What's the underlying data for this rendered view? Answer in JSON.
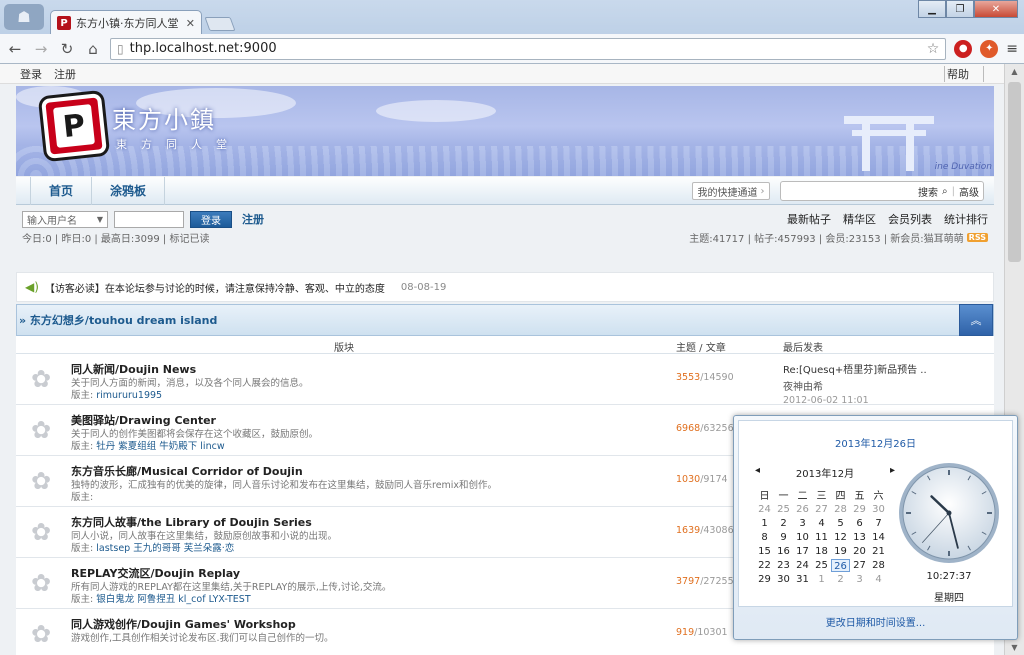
{
  "browser": {
    "tab_title": "东方小镇·东方同人堂 - Po",
    "tab_favicon": "P",
    "url": "thp.localhost.net:9000",
    "url_port": ":9000",
    "url_host": "thp.localhost.net"
  },
  "topbar": {
    "login": "登录",
    "register": "注册",
    "help": "帮助"
  },
  "banner": {
    "title": "東方小鎮",
    "subtitle": "東方同人堂",
    "caption": "ine Duvation"
  },
  "nav": {
    "items": [
      "首页",
      "涂鸦板"
    ],
    "quick": "我的快捷通道",
    "search": "搜索",
    "advanced": "高级"
  },
  "login": {
    "username_placeholder": "输入用户名",
    "button": "登录",
    "register": "注册",
    "links": [
      "最新帖子",
      "精华区",
      "会员列表",
      "统计排行"
    ]
  },
  "stats": {
    "left": "今日:0 | 昨日:0 | 最高日:3099 | 标记已读",
    "right": "主题:41717 | 帖子:457993 | 会员:23153 | 新会员:猫耳萌萌",
    "rss": "RSS"
  },
  "notice": {
    "text": "【访客必读】在本论坛参与讨论的时候，请注意保持冷静、客观、中立的态度",
    "date": "08-08-19"
  },
  "category": {
    "title": "» 东方幻想乡/touhou dream island",
    "col_forum": "版块",
    "col_count": "主题 / 文章",
    "col_last": "最后发表"
  },
  "forums": [
    {
      "name": "同人新闻/Doujin News",
      "desc": "关于同人方面的新闻，消息，以及各个同人展会的信息。",
      "mod_label": "版主:",
      "mods": "rimururu1995",
      "threads": "3553",
      "posts": "/14590",
      "last_title": "Re:[Quesq+梧里芬]新品预告 ..",
      "last_by": "夜神由希",
      "last_time": "2012-06-02 11:01"
    },
    {
      "name": "美图驿站/Drawing Center",
      "desc": "关于同人的创作美图都将会保存在这个收藏区，鼓励原创。",
      "mod_label": "版主:",
      "mods": "牡丹 紫夏组组 牛奶殿下 lincw",
      "threads": "6968",
      "posts": "/63256",
      "last_title": "",
      "last_by": "",
      "last_time": ""
    },
    {
      "name": "东方音乐长廊/Musical Corridor of Doujin",
      "desc": "独特的波形，汇成独有的优美的旋律，同人音乐讨论和发布在这里集结，鼓励同人音乐remix和创作。",
      "mod_label": "版主:",
      "mods": "",
      "threads": "1030",
      "posts": "/9174",
      "last_title": "",
      "last_by": "",
      "last_time": ""
    },
    {
      "name": "东方同人故事/the Library of Doujin Series",
      "desc": "同人小说，同人故事在这里集结，鼓励原创故事和小说的出现。",
      "mod_label": "版主:",
      "mods": "lastsep 王九的哥哥 芙兰朵露·恋",
      "threads": "1639",
      "posts": "/43086",
      "last_title": "",
      "last_by": "",
      "last_time": ""
    },
    {
      "name": "REPLAY交流区/Doujin Replay",
      "desc": "所有同人游戏的REPLAY都在这里集结,关于REPLAY的展示,上传,讨论,交流。",
      "mod_label": "版主:",
      "mods": "银白鬼龙 阿鲁捏丑 kl_cof LYX-TEST",
      "threads": "3797",
      "posts": "/27255",
      "last_title": "",
      "last_by": "",
      "last_time": ""
    },
    {
      "name": "同人游戏创作/Doujin Games' Workshop",
      "desc": "游戏创作,工具创作相关讨论发布区.我们可以自己创作的一切。",
      "mod_label": "",
      "mods": "",
      "threads": "919",
      "posts": "/10301",
      "last_title": "",
      "last_by": "",
      "last_time": ""
    }
  ],
  "clock": {
    "long_date": "2013年12月26日",
    "month_label": "2013年12月",
    "weekdays": [
      "日",
      "一",
      "二",
      "三",
      "四",
      "五",
      "六"
    ],
    "days": [
      [
        "24",
        "25",
        "26",
        "27",
        "28",
        "29",
        "30"
      ],
      [
        "1",
        "2",
        "3",
        "4",
        "5",
        "6",
        "7"
      ],
      [
        "8",
        "9",
        "10",
        "11",
        "12",
        "13",
        "14"
      ],
      [
        "15",
        "16",
        "17",
        "18",
        "19",
        "20",
        "21"
      ],
      [
        "22",
        "23",
        "24",
        "25",
        "26",
        "27",
        "28"
      ],
      [
        "29",
        "30",
        "31",
        "1",
        "2",
        "3",
        "4"
      ]
    ],
    "today": "26",
    "time": "10:27:37",
    "weekday": "星期四",
    "change_link": "更改日期和时间设置..."
  }
}
